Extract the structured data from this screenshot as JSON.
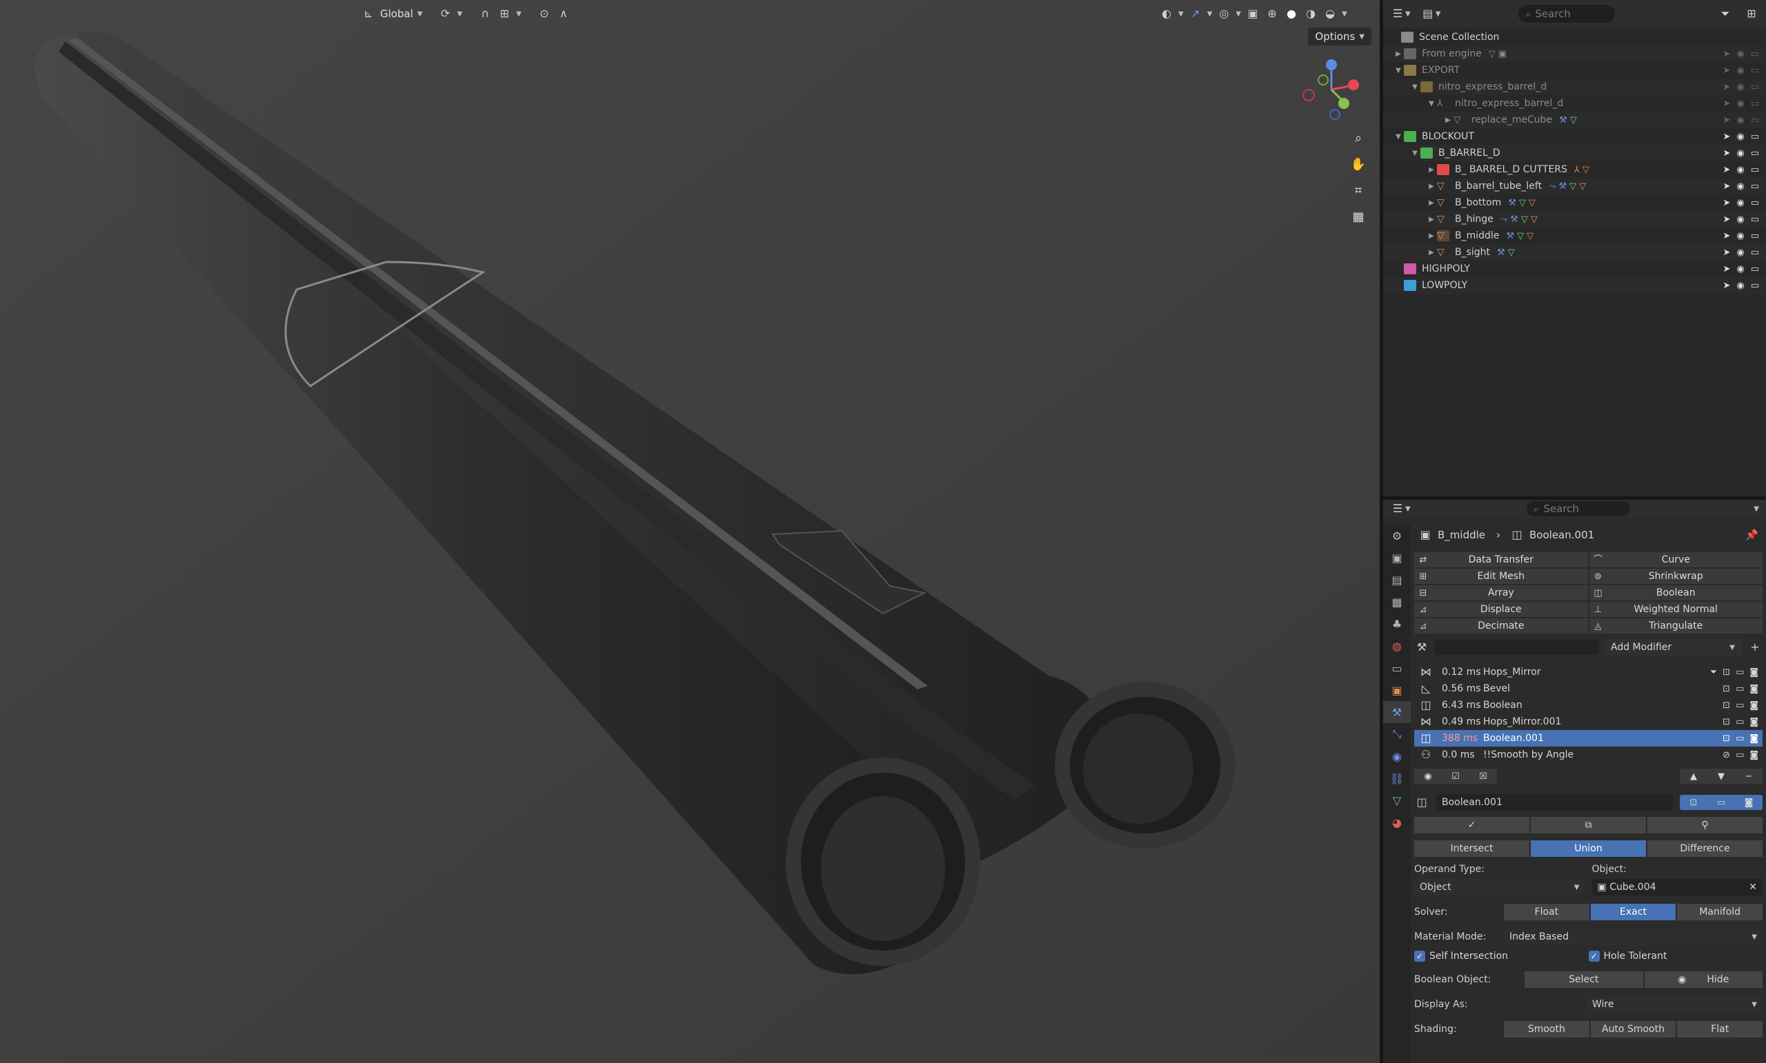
{
  "viewport": {
    "header": {
      "transform_orientation": "Global",
      "options_label": "Options"
    }
  },
  "outliner": {
    "search_placeholder": "Search",
    "rows": [
      {
        "label": "Scene Collection"
      },
      {
        "label": "From engine"
      },
      {
        "label": "EXPORT"
      },
      {
        "label": "nitro_express_barrel_d"
      },
      {
        "label": "nitro_express_barrel_d"
      },
      {
        "label": "replace_meCube"
      },
      {
        "label": "BLOCKOUT"
      },
      {
        "label": "B_BARREL_D"
      },
      {
        "label": "B_ BARREL_D CUTTERS"
      },
      {
        "label": "B_barrel_tube_left"
      },
      {
        "label": "B_bottom"
      },
      {
        "label": "B_hinge"
      },
      {
        "label": "B_middle"
      },
      {
        "label": "B_sight"
      },
      {
        "label": "HIGHPOLY"
      },
      {
        "label": "LOWPOLY"
      }
    ]
  },
  "properties": {
    "search_placeholder": "Search",
    "breadcrumb": {
      "object": "B_middle",
      "modifier": "Boolean.001"
    },
    "modifier_menu": [
      [
        "Data Transfer",
        "Curve"
      ],
      [
        "Edit Mesh",
        "Shrinkwrap"
      ],
      [
        "Array",
        "Boolean"
      ],
      [
        "Displace",
        "Weighted Normal"
      ],
      [
        "Decimate",
        "Triangulate"
      ]
    ],
    "add_modifier_label": "Add Modifier",
    "stack": [
      {
        "time": "0.12 ms",
        "name": "Hops_Mirror"
      },
      {
        "time": "0.56 ms",
        "name": "Bevel"
      },
      {
        "time": "6.43 ms",
        "name": "Boolean"
      },
      {
        "time": "0.49 ms",
        "name": "Hops_Mirror.001"
      },
      {
        "time": "388 ms",
        "name": "Boolean.001"
      },
      {
        "time": "0.0 ms",
        "name": "!!Smooth by Angle"
      }
    ],
    "boolean": {
      "name": "Boolean.001",
      "operations": [
        "Intersect",
        "Union",
        "Difference"
      ],
      "operand_type_label": "Operand Type:",
      "operand_type_value": "Object",
      "object_label": "Object:",
      "object_value": "Cube.004",
      "solver_label": "Solver:",
      "solvers": [
        "Float",
        "Exact",
        "Manifold"
      ],
      "material_mode_label": "Material Mode:",
      "material_mode_value": "Index Based",
      "self_intersection": "Self Intersection",
      "hole_tolerant": "Hole Tolerant",
      "boolean_object_label": "Boolean Object:",
      "select_label": "Select",
      "hide_label": "Hide",
      "display_as_label": "Display As:",
      "display_as_value": "Wire",
      "shading_label": "Shading:",
      "shading_options": [
        "Smooth",
        "Auto Smooth",
        "Flat"
      ]
    }
  }
}
